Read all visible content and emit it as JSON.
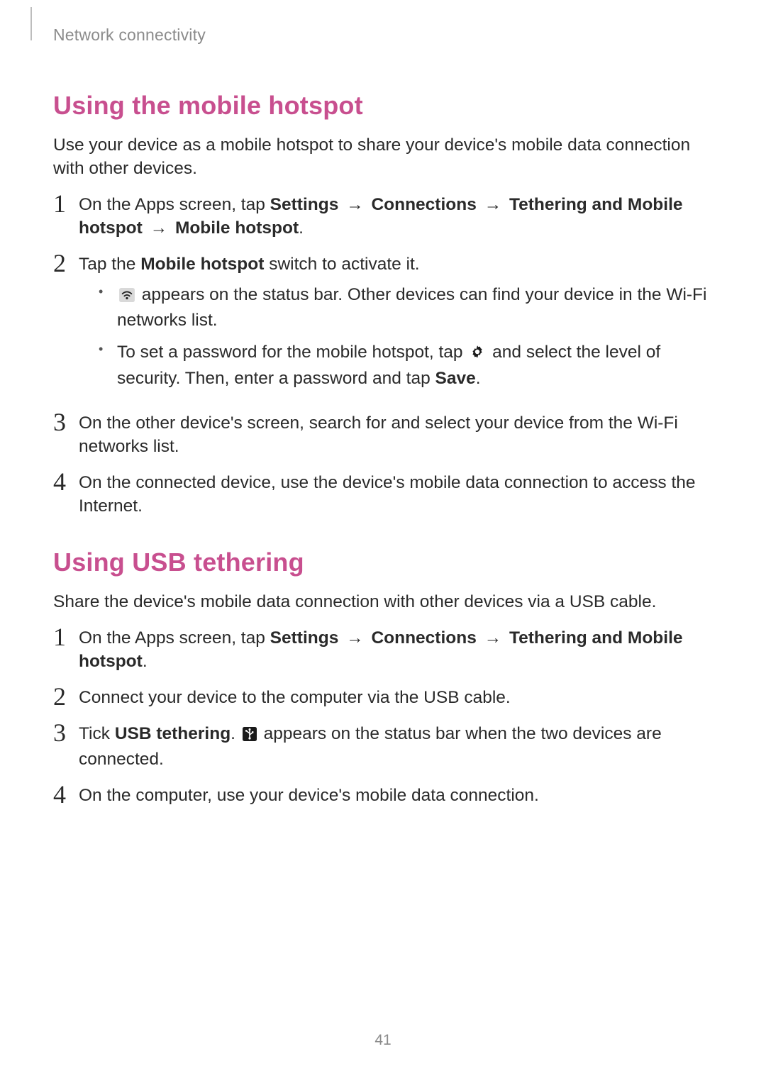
{
  "header": {
    "breadcrumb": "Network connectivity"
  },
  "page_number": "41",
  "sections": {
    "hotspot": {
      "title": "Using the mobile hotspot",
      "intro": "Use your device as a mobile hotspot to share your device's mobile data connection with other devices.",
      "steps": {
        "s1": {
          "num": "1",
          "pre": "On the Apps screen, tap ",
          "path": [
            "Settings",
            "Connections",
            "Tethering and Mobile hotspot",
            "Mobile hotspot"
          ],
          "post": "."
        },
        "s2": {
          "num": "2",
          "pre": "Tap the ",
          "bold": "Mobile hotspot",
          "post": " switch to activate it.",
          "sub": {
            "a": {
              "post": " appears on the status bar. Other devices can find your device in the Wi-Fi networks list."
            },
            "b": {
              "pre": "To set a password for the mobile hotspot, tap ",
              "mid": " and select the level of security. Then, enter a password and tap ",
              "bold": "Save",
              "post": "."
            }
          }
        },
        "s3": {
          "num": "3",
          "text": "On the other device's screen, search for and select your device from the Wi-Fi networks list."
        },
        "s4": {
          "num": "4",
          "text": "On the connected device, use the device's mobile data connection to access the Internet."
        }
      }
    },
    "usb": {
      "title": "Using USB tethering",
      "intro": "Share the device's mobile data connection with other devices via a USB cable.",
      "steps": {
        "s1": {
          "num": "1",
          "pre": "On the Apps screen, tap ",
          "path": [
            "Settings",
            "Connections",
            "Tethering and Mobile hotspot"
          ],
          "post": "."
        },
        "s2": {
          "num": "2",
          "text": "Connect your device to the computer via the USB cable."
        },
        "s3": {
          "num": "3",
          "pre": "Tick ",
          "bold": "USB tethering",
          "mid": ". ",
          "post": " appears on the status bar when the two devices are connected."
        },
        "s4": {
          "num": "4",
          "text": "On the computer, use your device's mobile data connection."
        }
      }
    }
  },
  "icons": {
    "hotspot_status": "hotspot-status-icon",
    "gear": "gear-icon",
    "usb_status": "usb-status-icon"
  },
  "colors": {
    "accent": "#c84f8f",
    "muted": "#8b8b8b",
    "text": "#2a2a2a"
  }
}
